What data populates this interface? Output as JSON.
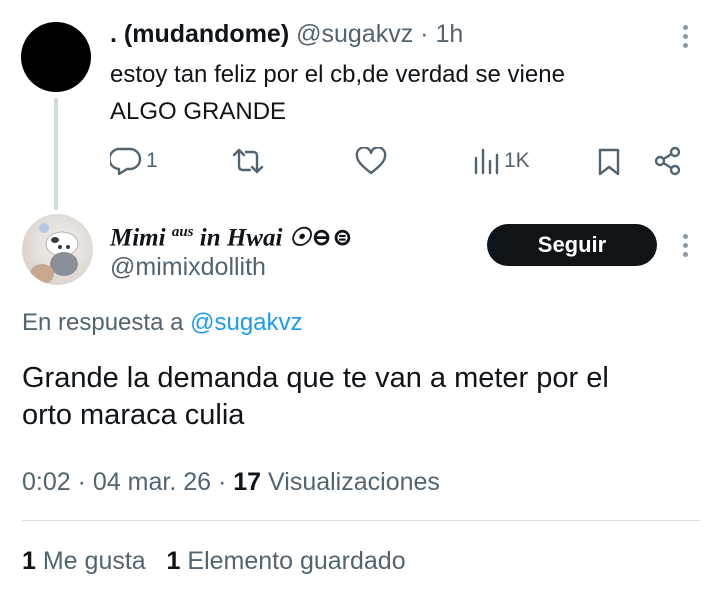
{
  "parent_tweet": {
    "display_name": ". (mudandome)",
    "handle": "@sugakvz",
    "separator": "·",
    "time": "1h",
    "text_lines": [
      "estoy tan feliz por el cb,de verdad se viene",
      "ALGO GRANDE"
    ],
    "actions": {
      "replies": "1",
      "retweets": "",
      "likes": "",
      "views": "1K"
    }
  },
  "main_tweet": {
    "display_name": "Mimi",
    "name_superscript": "aus",
    "name_suffix": "in Hwai ☉⊖⊜",
    "handle": "@mimixdollith",
    "follow_label": "Seguir",
    "reply_prefix": "En respuesta a",
    "reply_mention": "@sugakvz",
    "text_lines": [
      "Grande la demanda que te van a meter por el",
      "orto maraca culia"
    ],
    "time": "0:02",
    "separator": "·",
    "date": "04 mar. 26",
    "views_count": "17",
    "views_label": "Visualizaciones",
    "likes_count": "1",
    "likes_label": "Me gusta",
    "bookmarks_count": "1",
    "bookmarks_label": "Elemento guardado"
  },
  "colors": {
    "text_primary": "#0f1419",
    "text_secondary": "#536471",
    "accent": "#1d9bf0",
    "thread_line": "#cfd9de",
    "button_bg": "#0f1419"
  },
  "icons": [
    "reply-icon",
    "retweet-icon",
    "like-icon",
    "views-icon",
    "bookmark-icon",
    "share-icon",
    "more-options-icon"
  ]
}
